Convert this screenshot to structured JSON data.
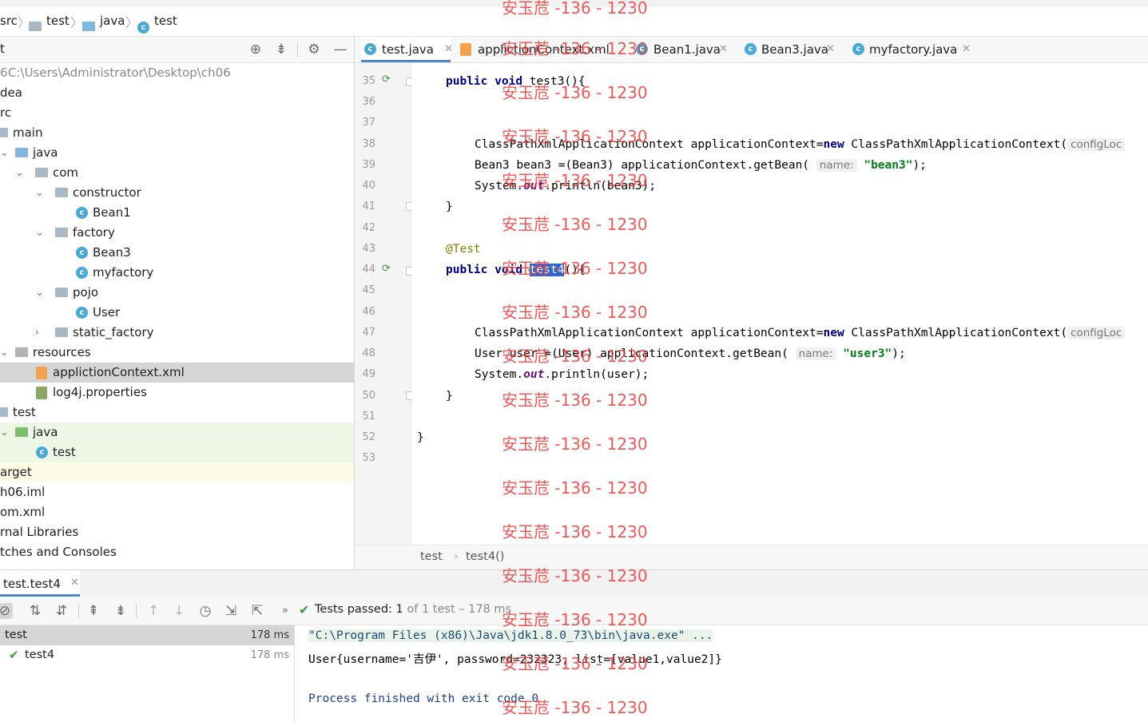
{
  "breadcrumb": {
    "items": [
      "src",
      "test",
      "java",
      "test"
    ]
  },
  "project_panel": {
    "title": "t",
    "rows": [
      {
        "label": "C:\\Users\\Administrator\\Desktop\\ch06",
        "prefix": "6"
      },
      {
        "label": "dea"
      },
      {
        "label": "rc"
      },
      {
        "label": "main"
      },
      {
        "label": "java"
      },
      {
        "label": "com"
      },
      {
        "label": "constructor"
      },
      {
        "label": "Bean1"
      },
      {
        "label": "factory"
      },
      {
        "label": "Bean3"
      },
      {
        "label": "myfactory"
      },
      {
        "label": "pojo"
      },
      {
        "label": "User"
      },
      {
        "label": "static_factory"
      },
      {
        "label": "resources"
      },
      {
        "label": "applictionContext.xml"
      },
      {
        "label": "log4j.properties"
      },
      {
        "label": "test"
      },
      {
        "label": "java"
      },
      {
        "label": "test"
      },
      {
        "label": "arget"
      },
      {
        "label": "h06.iml"
      },
      {
        "label": "om.xml"
      },
      {
        "label": "rnal Libraries"
      },
      {
        "label": "tches and Consoles"
      }
    ]
  },
  "editor": {
    "tabs": [
      {
        "label": "test.java",
        "active": true
      },
      {
        "label": "applictionContext.xml",
        "active": false
      },
      {
        "label": "Bean1.java",
        "active": false
      },
      {
        "label": "Bean3.java",
        "active": false
      },
      {
        "label": "myfactory.java",
        "active": false
      }
    ],
    "line_numbers": [
      "35",
      "36",
      "37",
      "38",
      "39",
      "40",
      "41",
      "42",
      "43",
      "44",
      "45",
      "46",
      "47",
      "48",
      "49",
      "50",
      "51",
      "52",
      "53"
    ],
    "code": {
      "l35_kw1": "public",
      "l35_kw2": "void",
      "l35_rest": " test3(){",
      "l38_a": "ClassPathXmlApplicationContext applicationContext=",
      "l38_new": "new",
      "l38_b": " ClassPathXmlApplicationContext(",
      "l38_hint": "configLoc",
      "l39_a": "Bean3 bean3 =(Bean3) applicationContext.getBean(",
      "l39_hint": "name:",
      "l39_str": "\"bean3\"",
      "l39_end": ");",
      "l40_a": "System.",
      "l40_out": "out",
      "l40_b": ".println(bean3);",
      "l41": "}",
      "l43_ann": "@Test",
      "l44_kw1": "public",
      "l44_kw2": "void",
      "l44_name": "test4",
      "l44_rest": "(){",
      "l47_a": "ClassPathXmlApplicationContext applicationContext=",
      "l47_new": "new",
      "l47_b": " ClassPathXmlApplicationContext(",
      "l47_hint": "configLoc",
      "l48_a": "User user =(User) applicationContext.getBean(",
      "l48_hint": "name:",
      "l48_str": "\"user3\"",
      "l48_end": ");",
      "l49_a": "System.",
      "l49_out": "out",
      "l49_b": ".println(user);",
      "l50": "}",
      "l52": "}"
    },
    "crumb": [
      "test",
      "test4()"
    ]
  },
  "run_panel": {
    "tab_label": "test.test4",
    "status_prefix": "Tests passed:",
    "status_count": "1",
    "status_suffix": "of 1 test – 178 ms",
    "tree": [
      {
        "label": "test",
        "time": "178 ms"
      },
      {
        "label": "test4",
        "time": "178 ms"
      }
    ],
    "console": [
      "\"C:\\Program Files (x86)\\Java\\jdk1.8.0_73\\bin\\java.exe\" ...",
      "User{username='吉伊', password=232323, list=[value1,value2]}",
      "",
      "Process finished with exit code 0"
    ]
  },
  "watermark": {
    "text": "安玉苊 -136 - 1230"
  },
  "colors": {
    "accent": "#4a88c7",
    "keyword": "#000080",
    "string": "#067d17",
    "annotation": "#808000",
    "pass_green": "#3d9a41",
    "watermark": "#ee3c3c"
  }
}
